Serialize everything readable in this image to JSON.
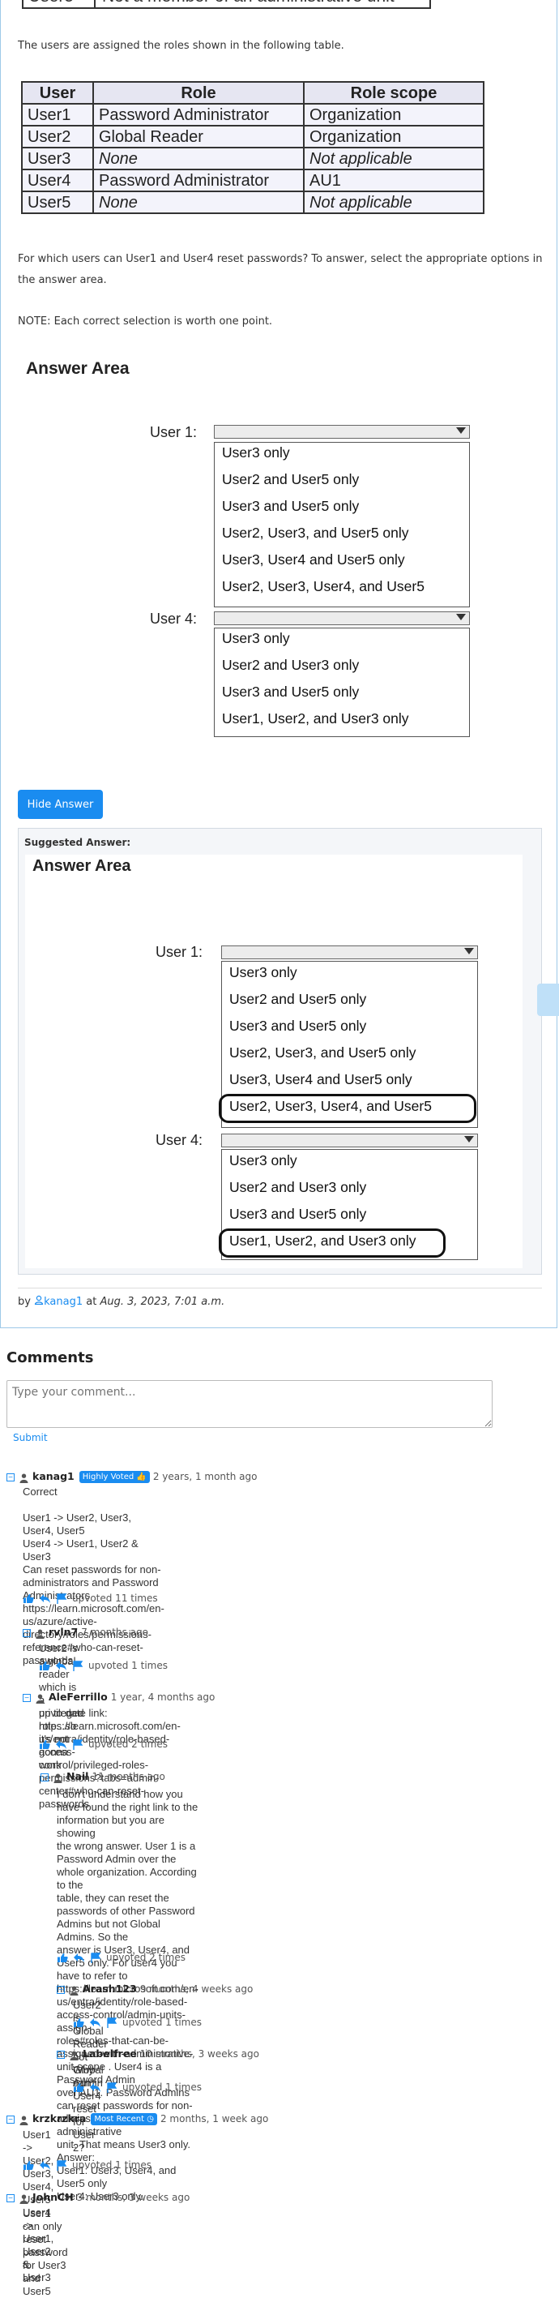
{
  "question": {
    "top_row": {
      "user": "User5",
      "value": "Not a member of an administrative unit"
    },
    "intro_text": "The users are assigned the roles shown in the following table.",
    "table": {
      "headers": [
        "User",
        "Role",
        "Role scope"
      ],
      "rows": [
        [
          "User1",
          "Password Administrator",
          "Organization"
        ],
        [
          "User2",
          "Global Reader",
          "Organization"
        ],
        [
          "User3",
          "None",
          "Not applicable"
        ],
        [
          "User4",
          "Password Administrator",
          "AU1"
        ],
        [
          "User5",
          "None",
          "Not applicable"
        ]
      ]
    },
    "prompt_line1": "For which users can User1 and User4 reset passwords? To answer, select the appropriate options in",
    "prompt_line2": "the answer area.",
    "note": "NOTE: Each correct selection is worth one point.",
    "answer_area_title": "Answer Area",
    "user1_label": "User 1:",
    "user4_label": "User 4:",
    "user1_options": [
      "User3 only",
      "User2 and User5 only",
      "User3 and User5 only",
      "User2, User3, and User5 only",
      "User3, User4 and User5 only",
      "User2, User3, User4, and User5"
    ],
    "user4_options": [
      "User3 only",
      "User2 and User3 only",
      "User3 and User5 only",
      "User1, User2, and User3 only"
    ]
  },
  "hide_answer_label": "Hide Answer",
  "suggested": {
    "label": "Suggested Answer:",
    "title": "Answer Area",
    "user1_selected": "User2, User3, User4, and User5",
    "user4_selected": "User1, User2, and User3 only"
  },
  "byline": {
    "prefix": "by",
    "author": "kanag1",
    "at": "at",
    "date": "Aug. 3, 2023, 7:01 a.m."
  },
  "comments_heading": "Comments",
  "comment_placeholder": "Type your comment...",
  "submit_label": "Submit",
  "comments": [
    {
      "user": "kanag1",
      "badge": "Highly Voted",
      "ago": "2 years, 1 month ago",
      "text": "Correct\n\nUser1 -> User2, User3, User4, User5\nUser4 -> User1, User2 & User3\nCan reset passwords for non-administrators and Password Administrators\nhttps://learn.microsoft.com/en-us/azure/active-directory/roles/permissions-reference#who-can-reset-\npasswords",
      "votes": "upvoted 11 times"
    },
    {
      "user": "rvln7",
      "ago": "7 months ago",
      "text": "User2 is a global reader which is a privileged role...so it's not gonna work",
      "votes": "upvoted 1 times"
    },
    {
      "user": "AleFerrillo",
      "ago": "1 year, 4 months ago",
      "text": "up to date link: https://learn.microsoft.com/en-us/entra/identity/role-based-access-\ncontrol/privileged-roles-permissions?tabs=admin-center#who-can-reset-passwords",
      "votes": "upvoted 2 times"
    },
    {
      "user": "Nail",
      "ago": "11 months ago",
      "text": "I don't understand how you have found the right link to the information but you are showing\nthe wrong answer. User 1 is a Password Admin over the whole organization. According to the\ntable, they can reset the passwords of other Password Admins but not Global Admins. So the\nanswer is User3, User4, and User5 only. For user4 you have to refer to\nhttps://learn.microsoft.com/en-us/entra/identity/role-based-access-control/admin-units-assign-\nroles#roles-that-can-be-assigned-with-administrative-unit-scope . User4 is a Password Admin\nover AU1. Password Admins can reset passwords for non-admins only in the administrative\nunit. That means User3 only.\nAnswer:\nUser1: User3, User4, and User5 only\nUser4: User3 only.",
      "votes": "upvoted 2 times"
    },
    {
      "user": "Arash123",
      "ago": "9 months, 4 weeks ago",
      "text": "User2 is Global Reader not Global Admin",
      "votes": "upvoted 1 times"
    },
    {
      "user": "Labelfree",
      "ago": "10 months, 3 weeks ago",
      "text": "Why can't User4 reset for User 2?",
      "votes": "upvoted 1 times"
    },
    {
      "user": "krzkrzkra",
      "badge": "Most Recent",
      "ago": "2 months, 1 week ago",
      "text": "User1 -> User2, User3, User4, User5\nUser4 -> User1, User2 & User3",
      "votes": "upvoted 1 times"
    },
    {
      "user": "JohnCH",
      "ago": "3 months, 3 weeks ago",
      "text": "User1 can only reset password for User3 and User5",
      "votes": ""
    }
  ],
  "colors": {
    "accent": "#1a8cf0",
    "border": "#9ec9e8"
  }
}
